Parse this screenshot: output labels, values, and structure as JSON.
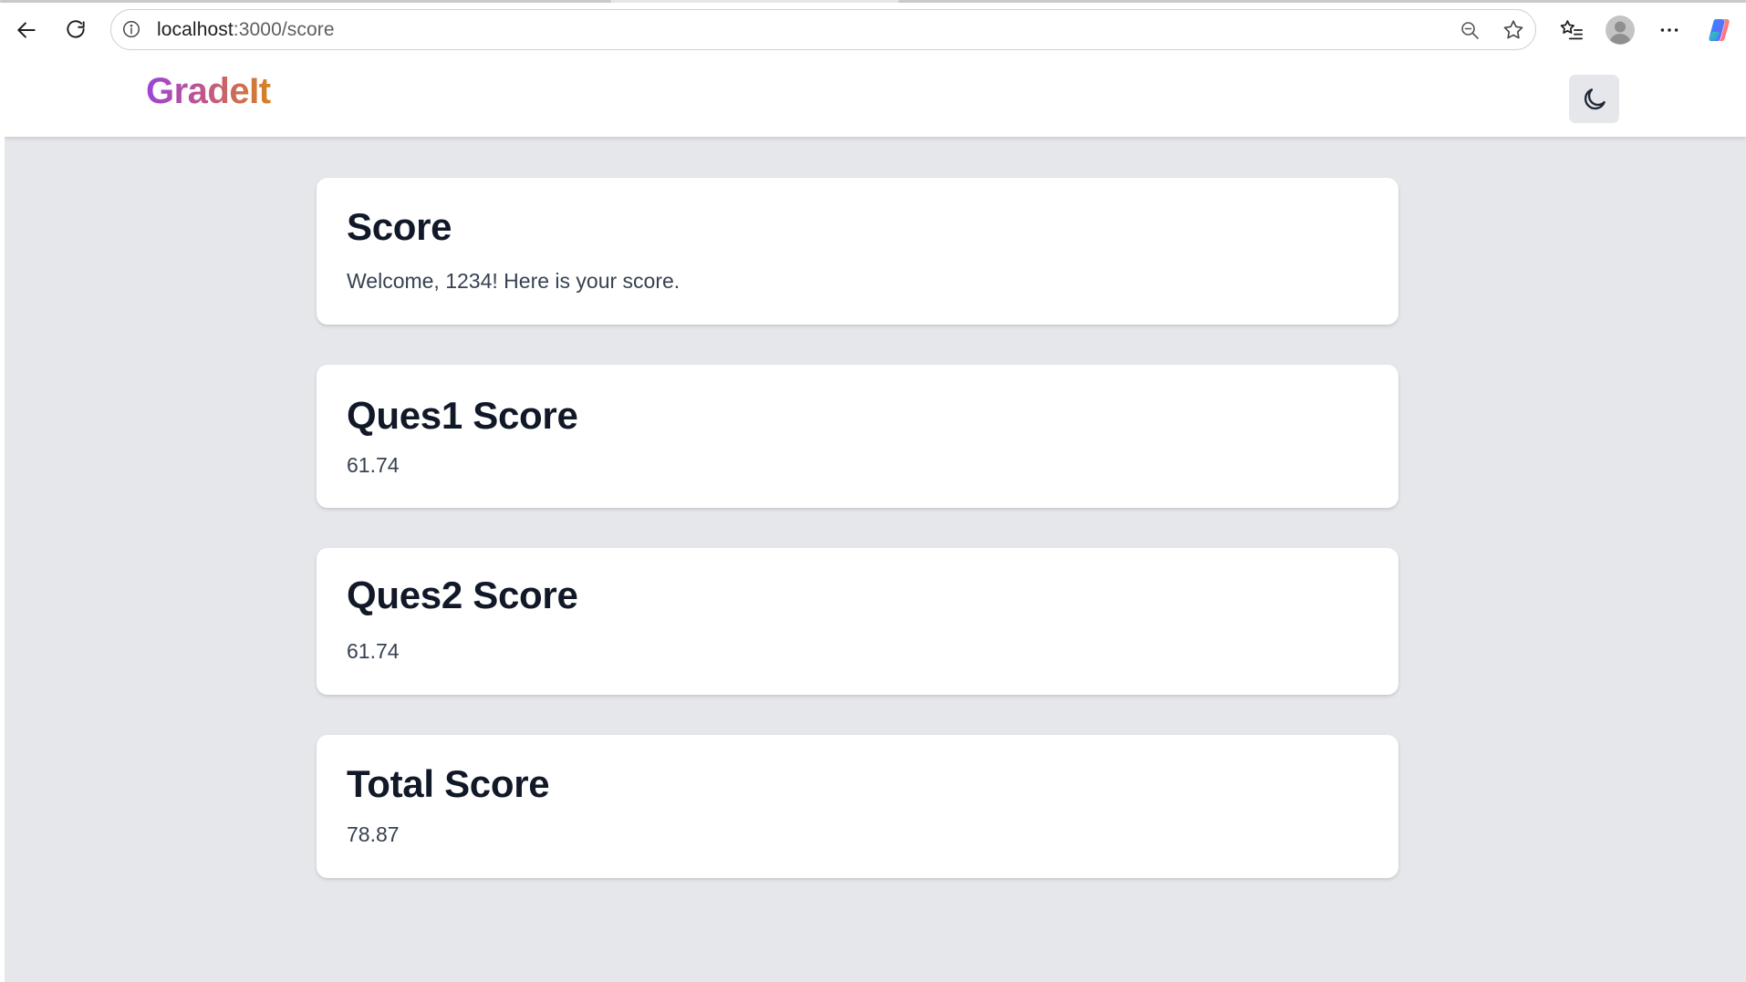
{
  "browser": {
    "url_host": "localhost",
    "url_path": ":3000/score"
  },
  "site": {
    "brand": "GradeIt",
    "brand_colors": [
      "#9b45d6",
      "#c0568d",
      "#d7831f"
    ],
    "theme_toggle_icon": "moon-icon"
  },
  "cards": [
    {
      "title": "Score",
      "text": "Welcome, 1234! Here is your score."
    },
    {
      "title": "Ques1 Score",
      "text": "61.74"
    },
    {
      "title": "Ques2 Score",
      "text": "61.74"
    },
    {
      "title": "Total Score",
      "text": "78.87"
    }
  ],
  "colors": {
    "page_background": "#e5e7eb",
    "card_background": "#ffffff",
    "heading_text": "#111827",
    "body_text": "#374151"
  }
}
